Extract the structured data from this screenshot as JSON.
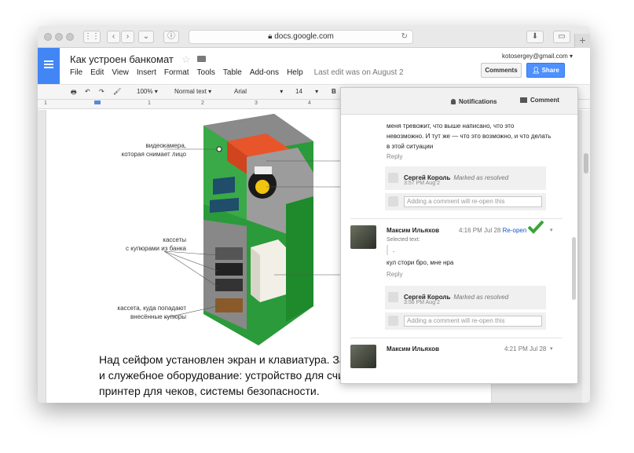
{
  "browser": {
    "url": "docs.google.com"
  },
  "docs": {
    "title": "Как устроен банкомат",
    "menu": [
      "File",
      "Edit",
      "View",
      "Insert",
      "Format",
      "Tools",
      "Table",
      "Add-ons",
      "Help"
    ],
    "last_edit": "Last edit was on August 2",
    "account_email": "kotosergey@gmail.com",
    "comments_label": "Comments",
    "share_label": "Share"
  },
  "toolbar": {
    "zoom": "100%",
    "style": "Normal text",
    "font": "Arial",
    "size": "14",
    "bold": "B"
  },
  "ruler": [
    "1",
    "1",
    "2",
    "3",
    "4"
  ],
  "illustration": {
    "captions": [
      "видеокамера,\nкоторая снимает лицо",
      "кассеты\nс купюрами из банка",
      "кассета, куда попадают\nвнесённые купюры"
    ]
  },
  "body_text": "Над сейфом установлен экран и клавиатура. За ними — компьютер и служебное оборудование: устройство для считывания карт, принтер для чеков, системы безопасности.",
  "comment_panel": {
    "notifications_label": "Notifications",
    "comment_label": "Comment",
    "thread1": {
      "text": "меня тревожит, что выше написано, что это невозможно. И тут же — что это возможно, и что делать в этой ситуации",
      "reply_label": "Reply",
      "resolved_by": "Сергей Король",
      "resolved_note": "Marked as resolved",
      "resolved_time": "3:57 PM Aug 2",
      "input_placeholder": "Adding a comment will re-open this"
    },
    "thread2": {
      "author": "Максим Ильяхов",
      "time": "4:16 PM Jul 28",
      "reopen_label": "Re-open",
      "selected_label": "Selected text:",
      "selected_text": ".",
      "text": "кул стори бро, мне нра",
      "reply_label": "Reply",
      "resolved_by": "Сергей Король",
      "resolved_note": "Marked as resolved",
      "resolved_time": "3:56 PM Aug 2",
      "input_placeholder": "Adding a comment will re-open this"
    },
    "thread3": {
      "author": "Максим Ильяхов",
      "time": "4:21 PM Jul 28"
    }
  }
}
